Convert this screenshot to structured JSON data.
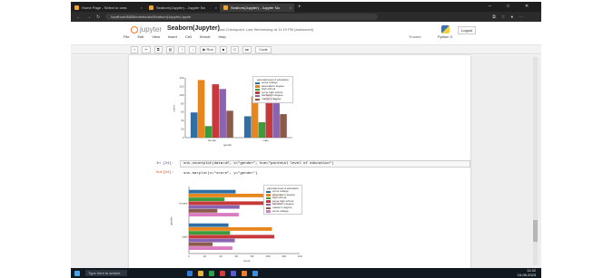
{
  "browser": {
    "tabs": [
      {
        "label": "Home Page - Select or crea"
      },
      {
        "label": "Seaborn(Jupyter) - Jupyter No"
      },
      {
        "label": "Seaborn(Jupyter) - Jupyter No"
      }
    ],
    "url": "localhost:8888/notebooks/Seaborn(Jupyter).ipynb"
  },
  "jupyter": {
    "logo_text": "jupyter",
    "notebook_title": "Seaborn(Jupyter)",
    "checkpoint": "Last Checkpoint: Last Wednesday at 11:19 PM (autosaved)",
    "logout": "Logout",
    "menu": [
      "File",
      "Edit",
      "View",
      "Insert",
      "Cell",
      "Kernel",
      "Help"
    ],
    "trusted": "Trusted",
    "kernel": "Python 3",
    "toolbar": [
      "+",
      "✂",
      "⧉",
      "▤",
      "↑",
      "↓",
      "▶ Run",
      "■",
      "C",
      "▸▸"
    ],
    "cell_type": "Code"
  },
  "cells": {
    "in_prompt": "In [24]:",
    "in_code": "sns.countplot(data=df, x=\"gender\", hue=\"parental level of education\")",
    "out_prompt": "Out[24]:",
    "out_code": "sns.barplot(x=\"score\", y=\"gender\")"
  },
  "chart_data": [
    {
      "type": "bar",
      "categories": [
        "female",
        "male"
      ],
      "xlabel": "gender",
      "ylabel": "count",
      "ylim": [
        0,
        140
      ],
      "yticks": [
        "0",
        "20",
        "40",
        "60",
        "80",
        "100",
        "120",
        "140"
      ],
      "legend_title": "parental level of education",
      "legend_position": "top-right",
      "series": [
        {
          "name": "some college",
          "color": "#2f6fa5",
          "values": [
            59,
            50
          ]
        },
        {
          "name": "associate's degree",
          "color": "#e8861e",
          "values": [
            135,
            97
          ]
        },
        {
          "name": "high school",
          "color": "#3c9b3c",
          "values": [
            27,
            36
          ]
        },
        {
          "name": "some high school",
          "color": "#c7393a",
          "values": [
            125,
            102
          ]
        },
        {
          "name": "bachelor's degree",
          "color": "#8a64b0",
          "values": [
            114,
            93
          ]
        },
        {
          "name": "master's degree",
          "color": "#8c5a4b",
          "values": [
            63,
            55
          ]
        }
      ]
    },
    {
      "type": "bar",
      "orientation": "horizontal",
      "categories": [
        "female",
        "male"
      ],
      "xlabel": "count",
      "ylabel": "gender",
      "xlim": [
        0,
        140
      ],
      "xticks": [
        "0",
        "20",
        "40",
        "60",
        "80",
        "100",
        "120",
        "140"
      ],
      "legend_title": "parental level of education",
      "legend_position": "top-right",
      "series": [
        {
          "name": "some college",
          "color": "#2f6fa5",
          "values": [
            59,
            50
          ]
        },
        {
          "name": "associate's degree",
          "color": "#e8861e",
          "values": [
            116,
            105
          ]
        },
        {
          "name": "high school",
          "color": "#3c9b3c",
          "values": [
            45,
            52
          ]
        },
        {
          "name": "some high school",
          "color": "#c7393a",
          "values": [
            118,
            108
          ]
        },
        {
          "name": "bachelor's degree",
          "color": "#8a64b0",
          "values": [
            64,
            58
          ]
        },
        {
          "name": "master's degree",
          "color": "#8c5a4b",
          "values": [
            36,
            30
          ]
        },
        {
          "name": "some college",
          "color": "#d97cc0",
          "values": [
            63,
            55
          ]
        }
      ]
    }
  ],
  "taskbar": {
    "search": "Type here to search",
    "time": "11:32",
    "date": "16-08-2023"
  }
}
